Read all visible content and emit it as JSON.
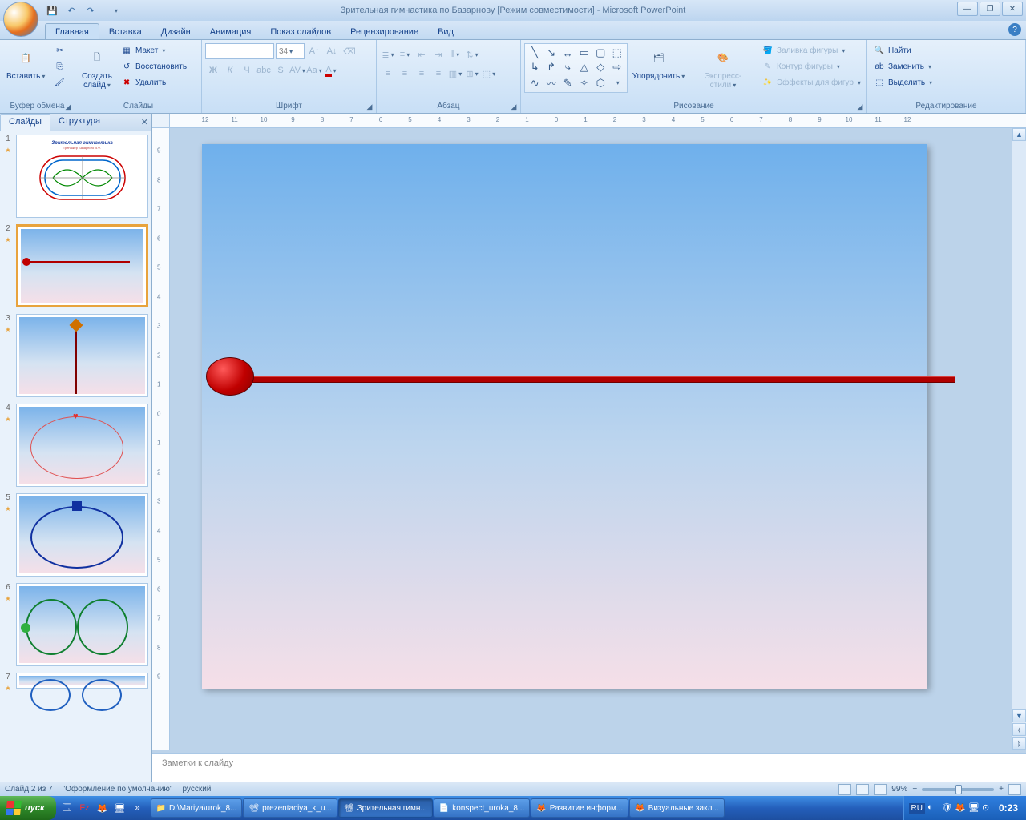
{
  "title": "Зрительная гимнастика по Базарнову [Режим совместимости] - Microsoft PowerPoint",
  "tabs": {
    "home": "Главная",
    "insert": "Вставка",
    "design": "Дизайн",
    "animation": "Анимация",
    "slideshow": "Показ слайдов",
    "review": "Рецензирование",
    "view": "Вид"
  },
  "ribbon": {
    "clipboard": {
      "label": "Буфер обмена",
      "paste": "Вставить"
    },
    "slides": {
      "label": "Слайды",
      "new_slide": "Создать\nслайд",
      "layout": "Макет",
      "reset": "Восстановить",
      "delete": "Удалить"
    },
    "font": {
      "label": "Шрифт",
      "size": "34"
    },
    "paragraph": {
      "label": "Абзац"
    },
    "drawing": {
      "label": "Рисование",
      "arrange": "Упорядочить",
      "quick_styles": "Экспресс-стили",
      "fill": "Заливка фигуры",
      "outline": "Контур фигуры",
      "effects": "Эффекты для фигур"
    },
    "editing": {
      "label": "Редактирование",
      "find": "Найти",
      "replace": "Заменить",
      "select": "Выделить"
    }
  },
  "panel": {
    "slides_tab": "Слайды",
    "outline_tab": "Структура"
  },
  "ruler_labels": [
    "12",
    "11",
    "10",
    "9",
    "8",
    "7",
    "6",
    "5",
    "4",
    "3",
    "2",
    "1",
    "0",
    "1",
    "2",
    "3",
    "4",
    "5",
    "6",
    "7",
    "8",
    "9",
    "10",
    "11",
    "12"
  ],
  "ruler_v_labels": [
    "9",
    "8",
    "7",
    "6",
    "5",
    "4",
    "3",
    "2",
    "1",
    "0",
    "1",
    "2",
    "3",
    "4",
    "5",
    "6",
    "7",
    "8",
    "9"
  ],
  "notes_placeholder": "Заметки к слайду",
  "status": {
    "slide_info": "Слайд 2 из 7",
    "theme": "\"Оформление по умолчанию\"",
    "lang": "русский",
    "zoom": "99%"
  },
  "thumb_title_1a": "Зрительная гимнастика",
  "thumb_title_1b": "Тренажер Базарного В.Ф.",
  "taskbar": {
    "start": "пуск",
    "items": [
      "D:\\Mariya\\urok_8...",
      "prezentaciya_k_u...",
      "Зрительная гимн...",
      "konspect_uroka_8...",
      "Развитие информ...",
      "Визуальные закл..."
    ],
    "lang": "RU",
    "time": "0:23"
  }
}
